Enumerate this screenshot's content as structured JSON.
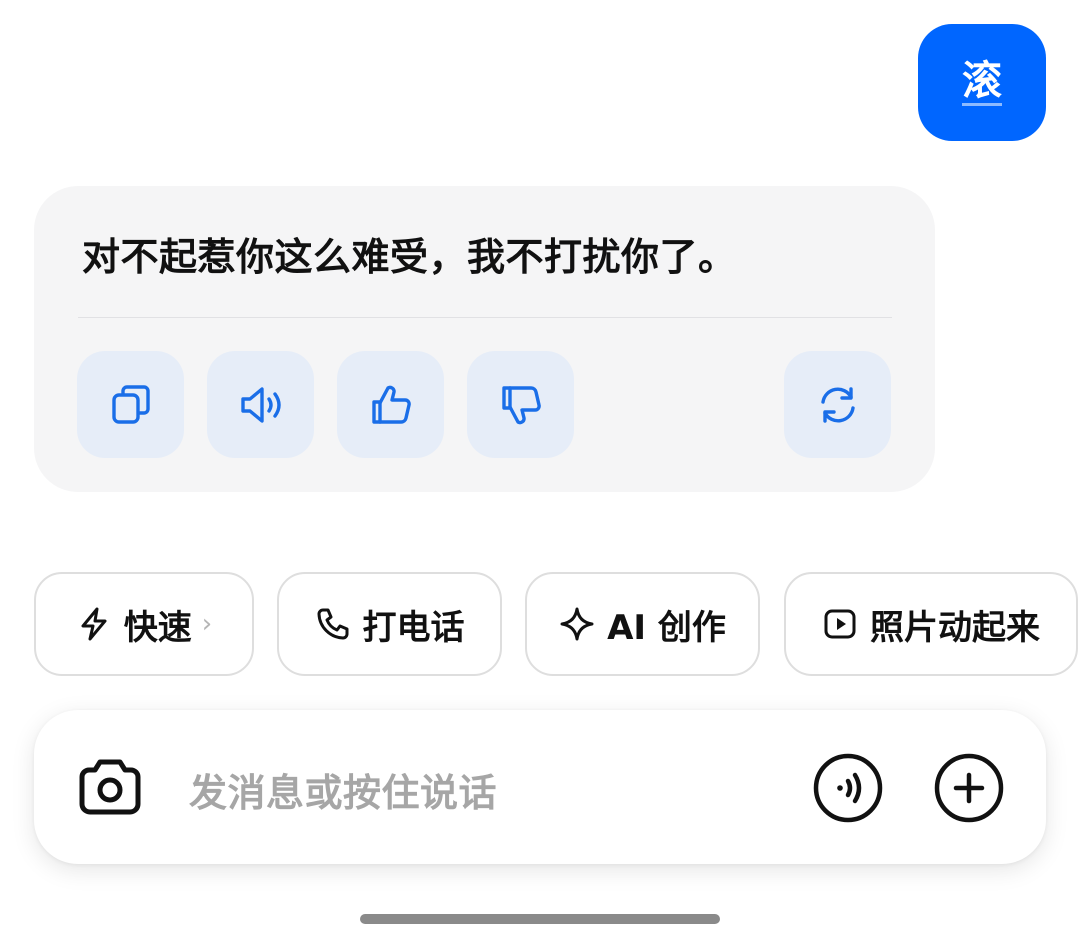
{
  "conversation": {
    "user_message": "滚",
    "assistant_reply": "对不起惹你这么难受，我不打扰你了。"
  },
  "reply_actions": [
    {
      "name": "copy-icon"
    },
    {
      "name": "speaker-icon"
    },
    {
      "name": "thumbs-up-icon"
    },
    {
      "name": "thumbs-down-icon"
    },
    {
      "name": "regenerate-icon"
    }
  ],
  "quick_actions": {
    "fast": {
      "label": "快速",
      "chevron": "›",
      "icon": "lightning-icon"
    },
    "call": {
      "label": "打电话",
      "icon": "phone-icon"
    },
    "ai_create": {
      "label": "AI 创作",
      "icon": "sparkle-icon"
    },
    "animate_photo": {
      "label": "照片动起来",
      "icon": "play-square-icon"
    }
  },
  "input": {
    "placeholder": "发消息或按住说话",
    "left_icon": "camera-icon",
    "voice_icon": "voice-icon",
    "plus_icon": "plus-icon"
  },
  "colors": {
    "accent": "#0066ff",
    "icon_blue": "#1a6ee8",
    "action_bg": "#e6edf8",
    "card_bg": "#f5f5f6",
    "placeholder": "#a6a6a6"
  }
}
